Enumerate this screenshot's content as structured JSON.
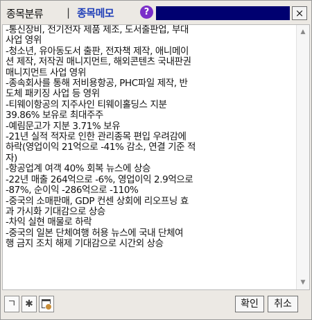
{
  "header": {
    "tab_category": "종목분류",
    "separator": "|",
    "tab_memo": "종목메모",
    "help_symbol": "?",
    "close_symbol": "×",
    "colors": {
      "memo_tab": "#1f3fb8",
      "title_field": "#000070",
      "help_icon": "#7b2fc9"
    }
  },
  "memo": {
    "text": "-통신장비, 전기전자 제품 제조, 도서출판업, 부대\n사업 영위\n-청소년, 유아동도서 출판, 전자책 제작, 애니메이\n션 제작, 저작권 매니지먼트, 해외콘텐츠 국내판권\n매니지먼트 사업 영위\n-종속회사를 통해 저비용항공, PHC파일 제작, 반\n도체 패키징 사업 등 영위\n-티웨이항공의 지주사인 티웨이홀딩스 지분\n39.86% 보유로 최대주주\n-예림문고가 지분 3.71% 보유\n-21년 실적 적자로 인한 관리종목 편입 우려감에\n하락(영업이익 21억으로 -41% 감소, 연결 기준 적\n자)\n-항공업계 여객 40% 회복 뉴스에 상승\n-22년 매출 264억으로 -6%, 영업이익 2.9억으로\n-87%, 순이익 -286억으로 -110%\n-중국의 소매판매, GDP 컨센 상회에 리오프닝 효\n과 가시화 기대감으로 상승\n-차익 실현 매물로 하락\n-중국의 일본 단체여행 허용 뉴스에 국내 단체여\n행 금지 조치 해제 기대감으로 시간외 상승"
  },
  "scrollbar": {
    "up_symbol": "▲",
    "down_symbol": "▼"
  },
  "footer": {
    "font_button": "ㄱ",
    "settings_symbol": "✱",
    "ok_label": "확인",
    "cancel_label": "취소"
  }
}
